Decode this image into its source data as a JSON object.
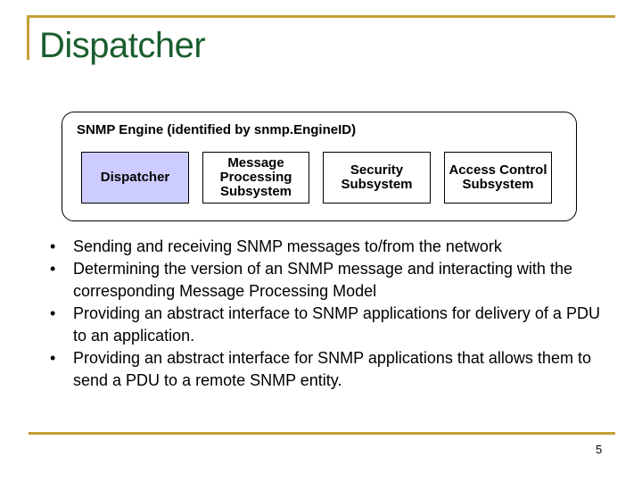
{
  "slide": {
    "title": "Dispatcher",
    "page_number": "5",
    "accent_color": "#C4A034",
    "title_color": "#1A5E2E"
  },
  "diagram": {
    "engine_label": "SNMP Engine (identified by snmp.EngineID)",
    "boxes": [
      {
        "label": "Dispatcher",
        "fill": "#CCCCFF"
      },
      {
        "label": "Message Processing Subsystem",
        "fill": "#FFFFFF"
      },
      {
        "label": "Security Subsystem",
        "fill": "#FFFFFF"
      },
      {
        "label": "Access Control Subsystem",
        "fill": "#FFFFFF"
      }
    ]
  },
  "bullets": [
    {
      "symbol": "•",
      "text": "Sending and receiving SNMP messages to/from the network"
    },
    {
      "symbol": "•",
      "text": "Determining the version of an SNMP message and interacting with the corresponding Message Processing Model"
    },
    {
      "symbol": "•",
      "text": "Providing an abstract interface to SNMP applications for delivery of a PDU to an application."
    },
    {
      "symbol": "•",
      "text": "Providing an abstract interface for SNMP applications that allows them to send a PDU to a remote SNMP entity."
    }
  ]
}
